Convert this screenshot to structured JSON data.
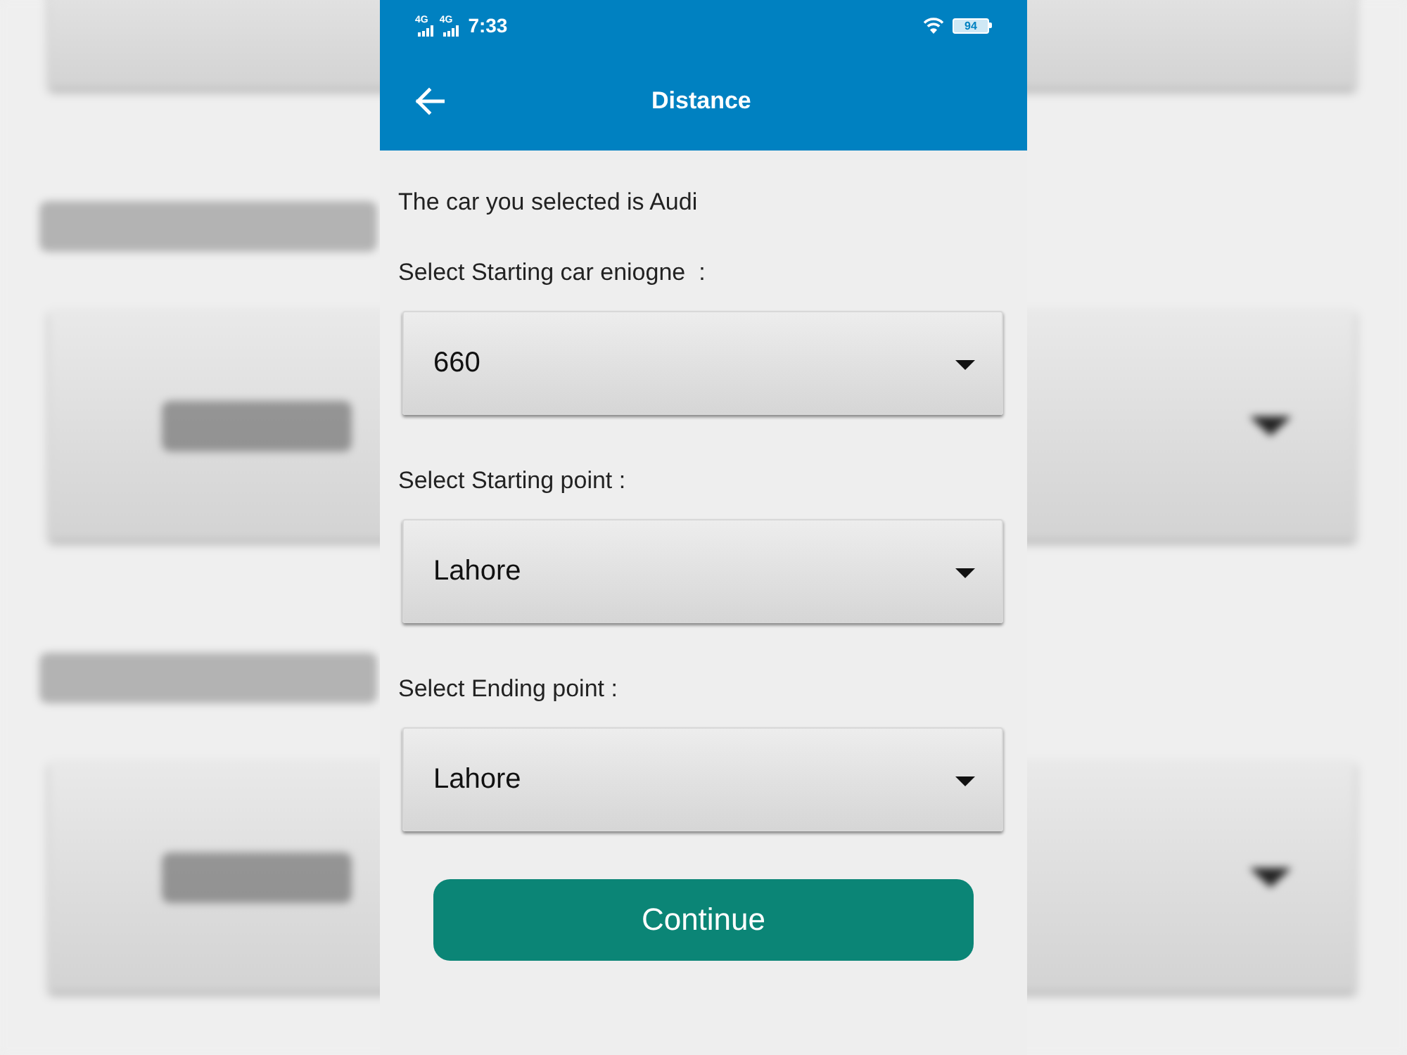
{
  "status_bar": {
    "signals": [
      {
        "network": "4G"
      },
      {
        "network": "4G"
      }
    ],
    "time": "7:33",
    "battery": "94"
  },
  "app_bar": {
    "title": "Distance"
  },
  "message": "The car you selected is Audi",
  "fields": [
    {
      "label": "Select Starting car eniogne  :",
      "value": "660"
    },
    {
      "label": "Select Starting point :",
      "value": "Lahore"
    },
    {
      "label": "Select Ending point :",
      "value": "Lahore"
    }
  ],
  "button": {
    "label": "Continue"
  }
}
